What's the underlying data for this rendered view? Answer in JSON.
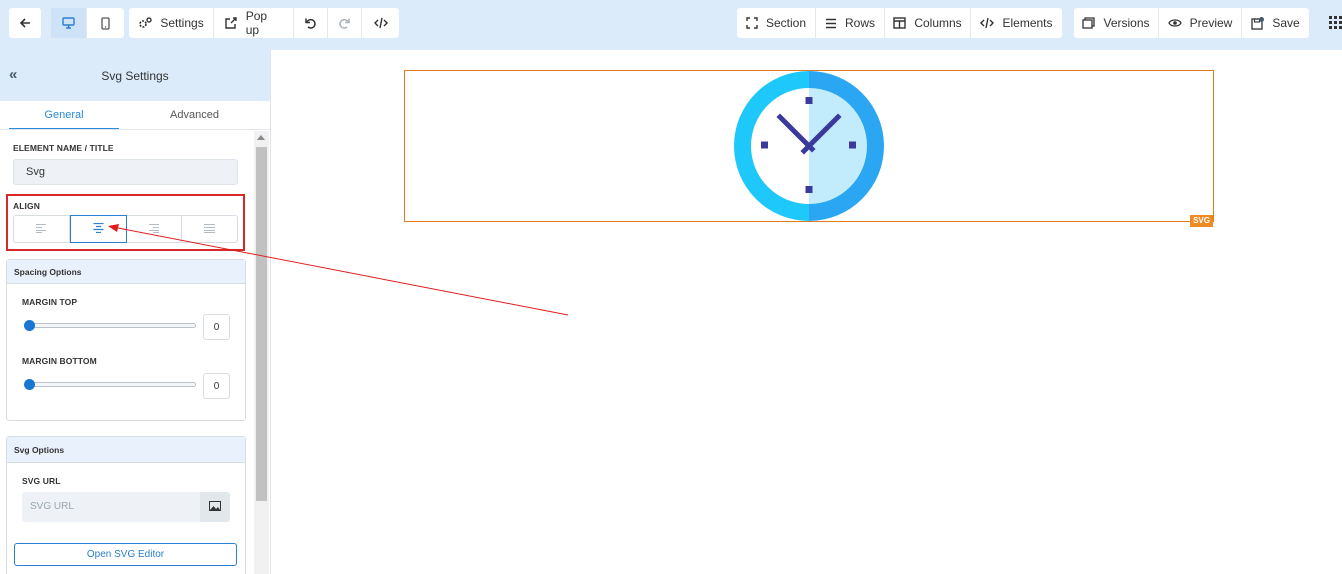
{
  "toolbar": {
    "settings_label": "Settings",
    "popup_label": "Pop up",
    "section_label": "Section",
    "rows_label": "Rows",
    "columns_label": "Columns",
    "elements_label": "Elements",
    "versions_label": "Versions",
    "preview_label": "Preview",
    "save_label": "Save",
    "icons": [
      "back-arrow-icon",
      "desktop-icon",
      "mobile-icon",
      "gear-icon",
      "popup-icon",
      "undo-icon",
      "redo-icon",
      "code-icon",
      "section-icon",
      "rows-icon",
      "columns-icon",
      "code-icon",
      "versions-icon",
      "eye-icon",
      "save-icon",
      "grid-icon"
    ]
  },
  "panel": {
    "title": "Svg Settings",
    "tabs": {
      "general": "General",
      "advanced": "Advanced"
    },
    "element_name_label": "ELEMENT NAME / TITLE",
    "element_name_value": "Svg",
    "align_label": "ALIGN",
    "align_options": [
      "left",
      "center",
      "right",
      "justify"
    ],
    "align_selected": "center",
    "spacing": {
      "title": "Spacing Options",
      "margin_top_label": "MARGIN TOP",
      "margin_top_value": "0",
      "margin_bottom_label": "MARGIN BOTTOM",
      "margin_bottom_value": "0"
    },
    "svg_options": {
      "title": "Svg Options",
      "url_label": "SVG URL",
      "url_placeholder": "SVG URL",
      "editor_button": "Open SVG Editor"
    }
  },
  "canvas": {
    "element_tag": "SVG",
    "element_icon": "clock-icon"
  },
  "colors": {
    "accent": "#2a7fd0",
    "toolbar_bg": "#dcebfa",
    "frame_border": "#e07b1f",
    "annotation_red": "#d62828"
  }
}
